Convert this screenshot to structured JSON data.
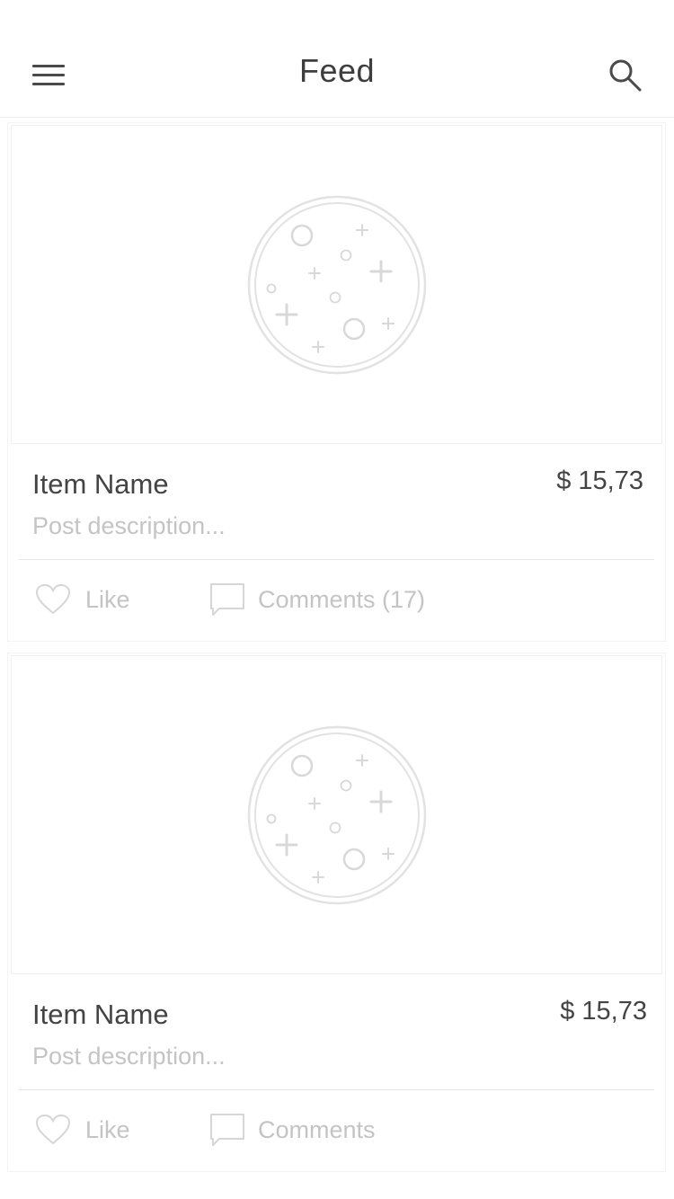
{
  "header": {
    "title": "Feed"
  },
  "posts": [
    {
      "name": "Item Name",
      "price": "$ 15,73",
      "description": "Post description...",
      "like_label": "Like",
      "comments_label": "Comments (17)"
    },
    {
      "name": "Item Name",
      "price": "$ 15,73",
      "description": "Post description...",
      "like_label": "Like",
      "comments_label": "Comments"
    }
  ],
  "icons": {
    "menu": "hamburger-menu-icon",
    "search": "search-icon",
    "image_placeholder": "image-placeholder-icon",
    "like": "heart-icon",
    "comments": "comment-bubble-icon"
  },
  "colors": {
    "background": "#ffffff",
    "text": "#444444",
    "muted_text": "#c4c4c4",
    "icon_muted": "#d6d6d6"
  }
}
